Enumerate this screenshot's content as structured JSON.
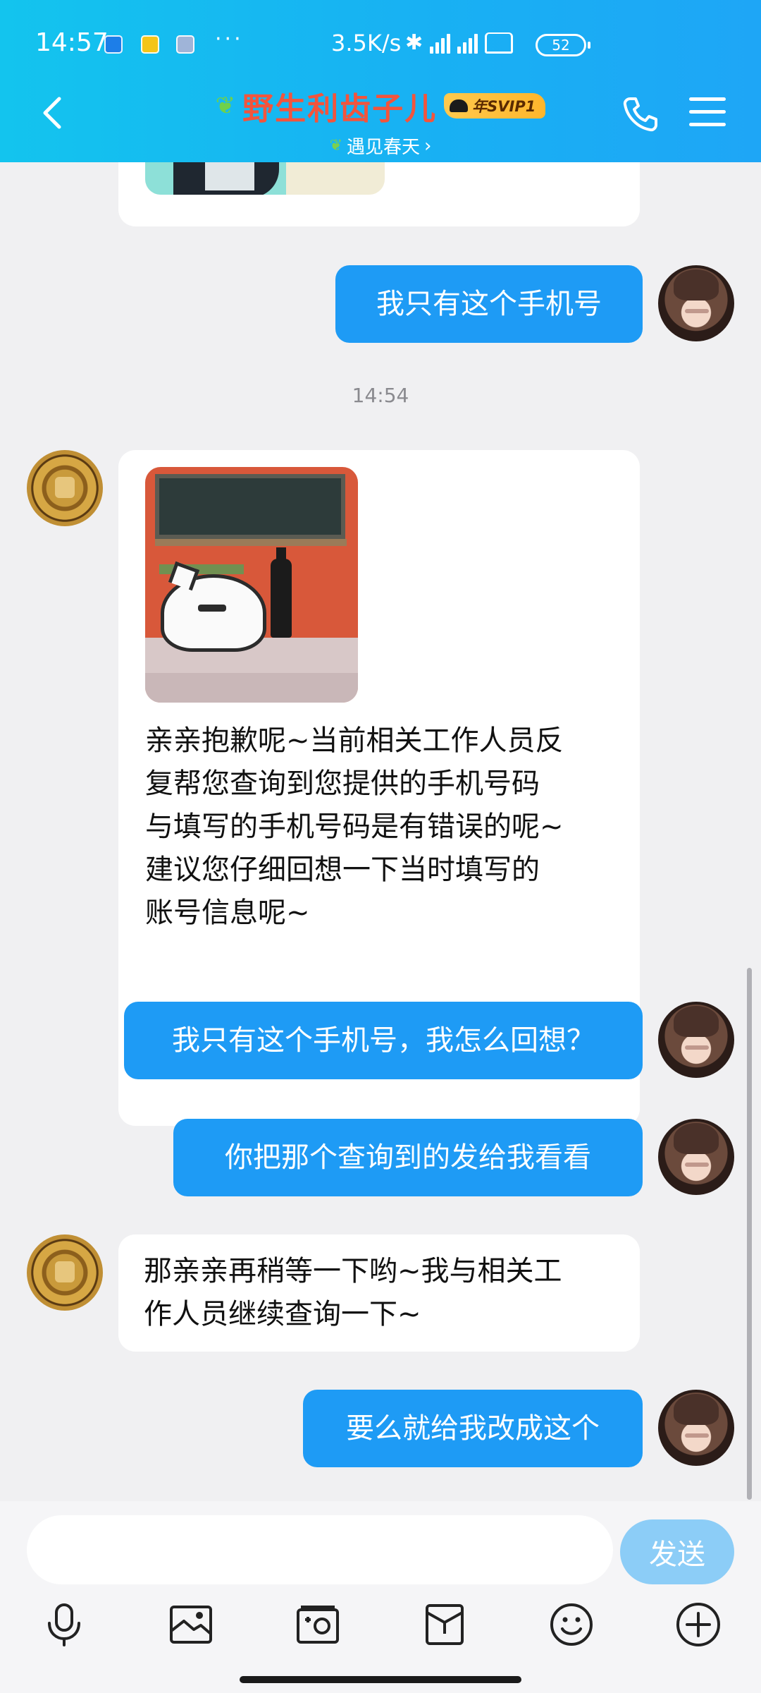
{
  "status_bar": {
    "time": "14:57",
    "dots": "···",
    "net_speed": "3.5K/s",
    "battery": "52"
  },
  "header": {
    "title": "野生利齿子儿",
    "vip_badge": "年SVIP1",
    "subtitle": "遇见春天",
    "subtitle_chevron": "›",
    "gradient": [
      "#13c4ee",
      "#1ea6f6"
    ],
    "title_color": "#f3543c"
  },
  "chat": {
    "messages": [
      {
        "side": "in",
        "type": "sticker",
        "image": "cartoon-sticker-partial"
      },
      {
        "side": "out",
        "type": "text",
        "text": "我只有这个手机号"
      },
      {
        "side": "system",
        "type": "time",
        "text": "14:54"
      },
      {
        "side": "in",
        "type": "sticker+text",
        "image": "cat-sticker",
        "lines": [
          "亲亲抱歉呢~当前相关工作人员反",
          "复帮您查询到您提供的手机号码",
          "与填写的手机号码是有错误的呢~",
          "建议您仔细回想一下当时填写的",
          "账号信息呢~"
        ]
      },
      {
        "side": "out",
        "type": "text",
        "text": "我只有这个手机号，我怎么回想？"
      },
      {
        "side": "out",
        "type": "text",
        "text": "你把那个查询到的发给我看看"
      },
      {
        "side": "in",
        "type": "text",
        "lines": [
          "那亲亲再稍等一下哟~我与相关工",
          "作人员继续查询一下~"
        ]
      },
      {
        "side": "out",
        "type": "text",
        "text": "要么就给我改成这个"
      }
    ],
    "bubble_out_color": "#1e9bf5",
    "bubble_in_color": "#ffffff"
  },
  "input": {
    "placeholder": "",
    "send_label": "发送",
    "send_color": "#8ccdf7"
  },
  "toolbar": [
    "mic-icon",
    "image-icon",
    "camera-icon",
    "red-packet-icon",
    "emoji-icon",
    "plus-icon"
  ]
}
